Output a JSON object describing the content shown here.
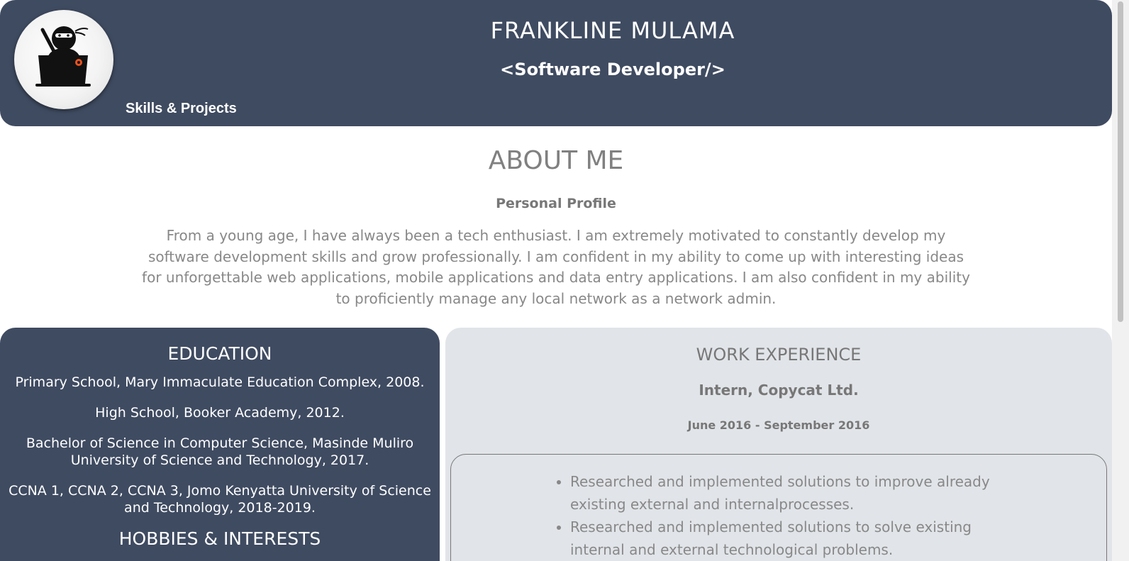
{
  "header": {
    "name": "FRANKLINE MULAMA",
    "title": "<Software Developer/>",
    "nav_link": "Skills & Projects",
    "avatar_icon": "ninja-laptop-icon"
  },
  "about": {
    "heading": "ABOUT ME",
    "subheading": "Personal Profile",
    "text": "From a young age, I have always been a tech enthusiast. I am extremely motivated to constantly develop my software development skills and grow professionally. I am confident in my ability to come up with interesting ideas for unforgettable web applications, mobile applications and data entry applications. I am also confident in my ability to proficiently manage any local network as a network admin."
  },
  "education": {
    "heading": "EDUCATION",
    "items": [
      "Primary School, Mary Immaculate Education Complex, 2008.",
      "High School, Booker Academy, 2012.",
      "Bachelor of Science in Computer Science, Masinde Muliro University of Science and Technology, 2017.",
      "CCNA 1, CCNA 2, CCNA 3, Jomo Kenyatta University of Science and Technology, 2018-2019."
    ]
  },
  "hobbies": {
    "heading": "HOBBIES & INTERESTS"
  },
  "work": {
    "heading": "WORK EXPERIENCE",
    "job_title": "Intern, Copycat Ltd.",
    "dates": "June 2016 - September 2016",
    "duties": [
      "Researched and implemented solutions to improve already existing external and internalprocesses.",
      "Researched and implemented solutions to solve existing internal and external technological problems."
    ]
  },
  "colors": {
    "header_bg": "#3f4b61",
    "work_bg": "#e1e4e8",
    "text_gray": "#808080",
    "accent_orange": "#e8531f"
  }
}
